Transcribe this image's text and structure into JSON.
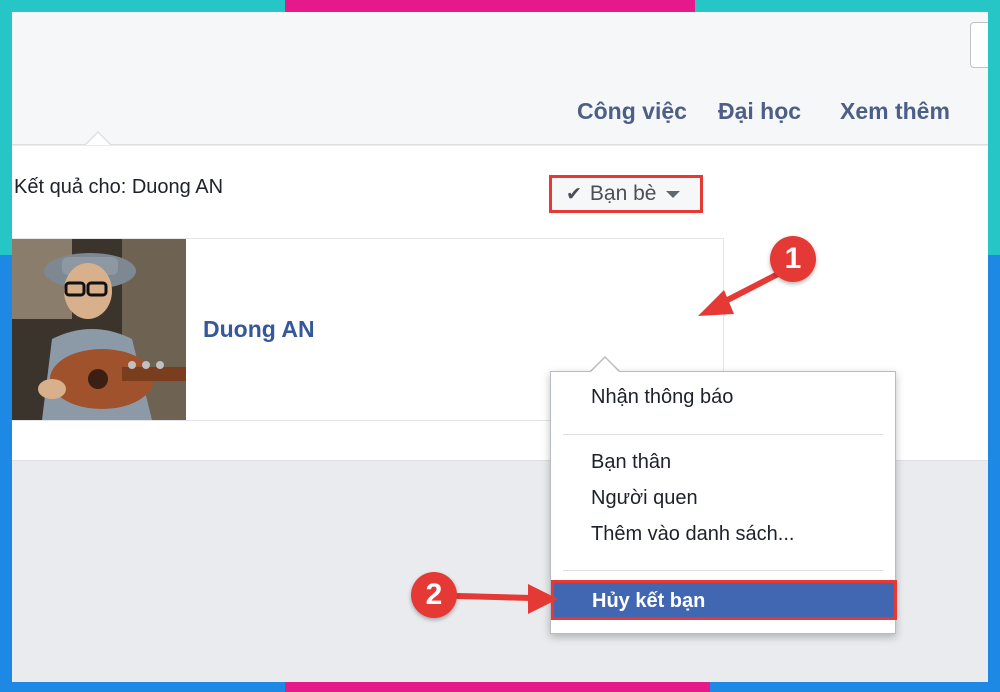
{
  "tabs": [
    {
      "label": "Công việc"
    },
    {
      "label": "Đại học"
    },
    {
      "label": "Xem thêm"
    }
  ],
  "results": {
    "heading": "Kết quả cho: Duong AN"
  },
  "person": {
    "name": "Duong AN"
  },
  "friend_button": {
    "label": "Bạn bè",
    "icon": "check-icon"
  },
  "dropdown": {
    "notifications": "Nhận thông báo",
    "close_friends": "Bạn thân",
    "acquaintances": "Người quen",
    "add_to_list": "Thêm vào danh sách...",
    "unfriend": "Hủy kết bạn"
  },
  "annotations": {
    "step1": "1",
    "step2": "2",
    "color": "#e53935"
  },
  "colors": {
    "link": "#365899",
    "tab": "#4b5f87",
    "highlight": "#4267b2",
    "frame_cyan": "#26c6c6",
    "frame_pink": "#e5198a",
    "frame_blue": "#1e88e5"
  }
}
